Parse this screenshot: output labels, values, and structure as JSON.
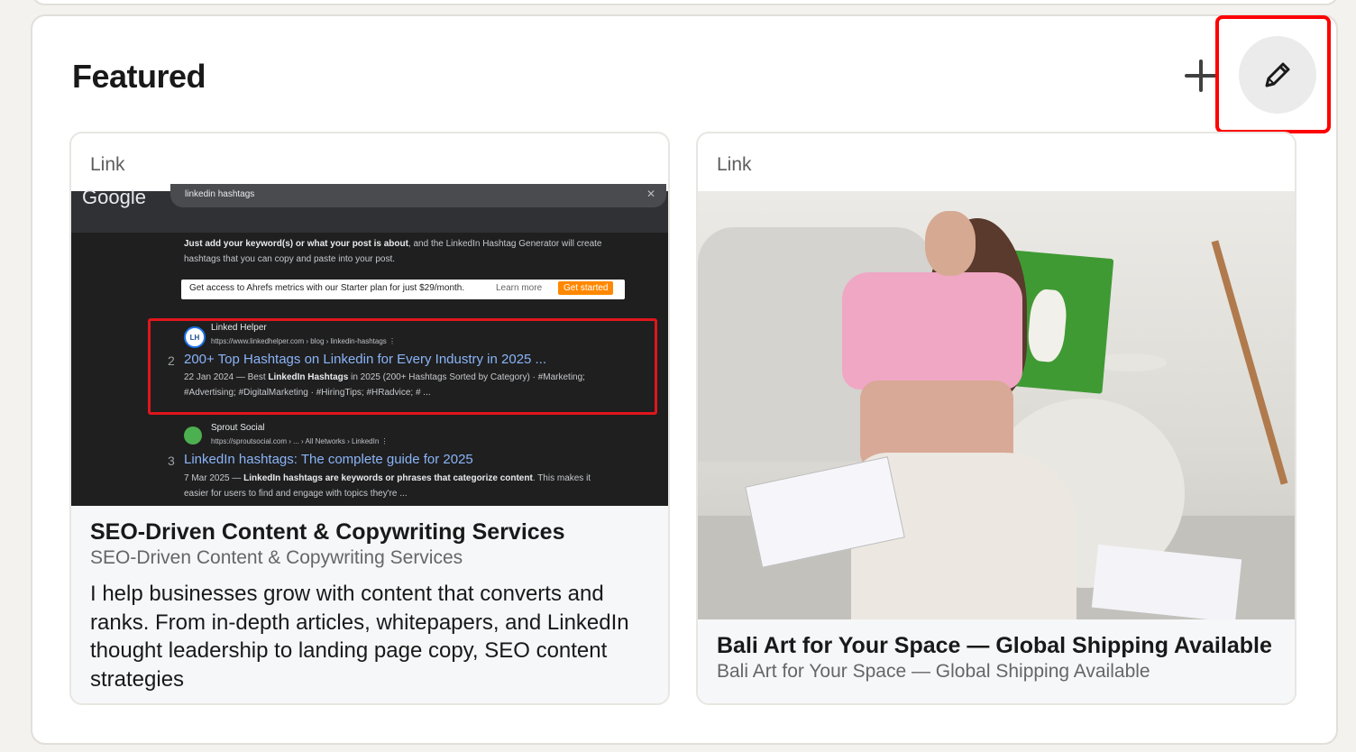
{
  "section": {
    "title": "Featured"
  },
  "actions": {
    "add_icon": "plus-icon",
    "edit_icon": "pencil-icon"
  },
  "cards": [
    {
      "type_label": "Link",
      "title": "SEO-Driven Content & Copywriting Services",
      "subtitle": "SEO-Driven Content & Copywriting Services",
      "description": "I help businesses grow with content that converts and ranks. From in-depth articles, whitepapers, and LinkedIn thought leadership to landing page copy, SEO content strategies",
      "thumbnail": {
        "logo": "Google",
        "query": "linkedin hashtags",
        "close": "✕",
        "intro_bold": "Just add your keyword(s) or what your post is about",
        "intro_rest": ", and the LinkedIn Hashtag Generator will create hashtags that you can copy and paste into your post.",
        "banner_text": "Get access to Ahrefs metrics with our Starter plan for just $29/month.",
        "banner_link": "Learn more",
        "banner_cta": "Get started",
        "results": [
          {
            "favicon": "LH",
            "site": "Linked Helper",
            "url": "https://www.linkedhelper.com › blog › linkedin-hashtags   ⋮",
            "num": "2",
            "title": "200+ Top Hashtags on Linkedin for Every Industry in 2025 ...",
            "snippet_a": "22 Jan 2024 — Best ",
            "snippet_bold": "LinkedIn Hashtags",
            "snippet_b": " in 2025 (200+ Hashtags Sorted by Category) · #Marketing;",
            "snippet_line2": "#Advertising; #DigitalMarketing · #HiringTips; #HRadvice; # ..."
          },
          {
            "favicon": "",
            "site": "Sprout Social",
            "url": "https://sproutsocial.com › ... › All Networks › LinkedIn   ⋮",
            "num": "3",
            "title": "LinkedIn hashtags: The complete guide for 2025",
            "snippet_a": "7 Mar 2025 — ",
            "snippet_bold": "LinkedIn hashtags are keywords or phrases that categorize content",
            "snippet_b": ". This makes it",
            "snippet_line2": "easier for users to find and engage with topics they're ..."
          }
        ]
      }
    },
    {
      "type_label": "Link",
      "title": "Bali Art for Your Space — Global Shipping Available",
      "subtitle": "Bali Art for Your Space — Global Shipping Available"
    }
  ],
  "colors": {
    "highlight": "#ff0000",
    "link_blue": "#8ab4f8",
    "cta_orange": "#ff8800"
  }
}
